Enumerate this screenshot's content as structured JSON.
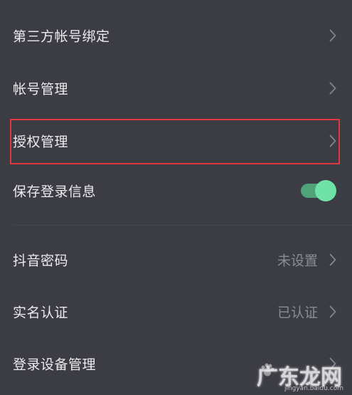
{
  "settings": {
    "items": [
      {
        "label": "第三方帐号绑定",
        "value": ""
      },
      {
        "label": "帐号管理",
        "value": ""
      },
      {
        "label": "授权管理",
        "value": ""
      },
      {
        "label": "保存登录信息",
        "toggle_on": true
      },
      {
        "label": "抖音密码",
        "value": "未设置"
      },
      {
        "label": "实名认证",
        "value": "已认证"
      },
      {
        "label": "登录设备管理",
        "value": ""
      }
    ]
  },
  "watermark": {
    "text": "广东龙网",
    "sub": "jingyan.baidu.com"
  },
  "colors": {
    "background": "#3b3c44",
    "text": "#ececef",
    "secondary_text": "#8c8d94",
    "highlight_border": "#e0373d",
    "toggle_track": "#50a278",
    "toggle_knob": "#6fe3a7"
  },
  "icons": {
    "row_arrow": "chevron-right-icon",
    "watermark_logo": "paw-icon"
  }
}
